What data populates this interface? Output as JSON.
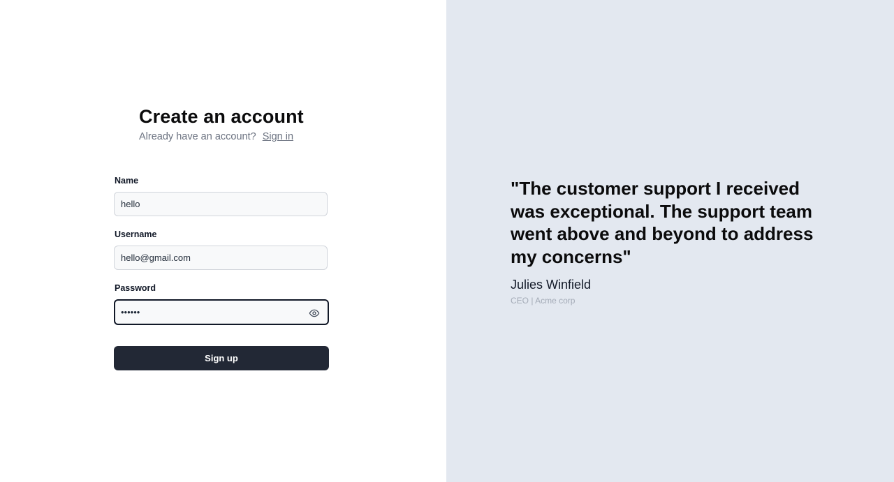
{
  "signup": {
    "title": "Create an account",
    "have_account_text": "Already have an account?",
    "signin_link": "Sign in",
    "fields": {
      "name": {
        "label": "Name",
        "value": "hello"
      },
      "username": {
        "label": "Username",
        "value": "hello@gmail.com"
      },
      "password": {
        "label": "Password",
        "value": "••••••",
        "show_icon": "eye-icon"
      }
    },
    "submit_label": "Sign up"
  },
  "testimonial": {
    "quote": "\"The customer support I received was exceptional. The support team went above and beyond to address my concerns\"",
    "author": "Julies Winfield",
    "role": "CEO | Acme corp"
  },
  "colors": {
    "left_background": "#ffffff",
    "right_background": "#e3e8f0",
    "button_background": "#222835",
    "button_text": "#ffffff",
    "muted_text": "#6b7280"
  }
}
